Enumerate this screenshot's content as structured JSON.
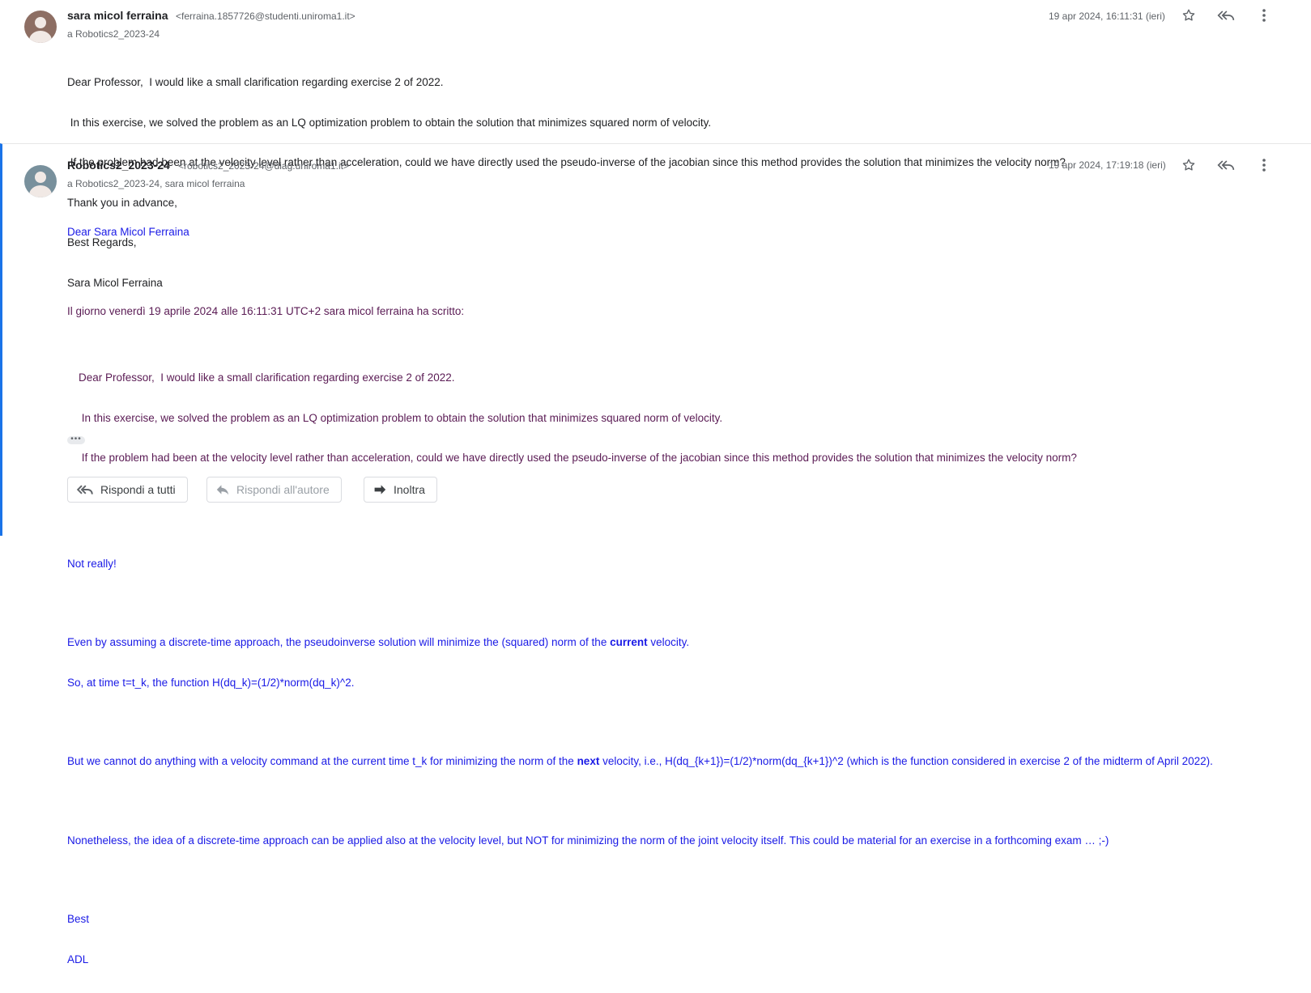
{
  "messages": [
    {
      "sender": "sara micol ferraina",
      "email": "<ferraina.1857726@studenti.uniroma1.it>",
      "recipients": "a Robotics2_2023-24",
      "date": "19 apr 2024, 16:11:31 (ieri)",
      "body": [
        "Dear Professor,  I would like a small clarification regarding exercise 2 of 2022.",
        " In this exercise, we solved the problem as an LQ optimization problem to obtain the solution that minimizes squared norm of velocity.",
        " If the problem had been at the velocity level rather than acceleration, could we have directly used the pseudo-inverse of the jacobian since this method provides the solution that minimizes the velocity norm?",
        "Thank you in advance,",
        "Best Regards,",
        "Sara Micol Ferraina"
      ]
    },
    {
      "sender": "Robotics2_2023-24",
      "email": "<robotics2_2023-24@diag.uniroma1.it>",
      "recipients": "a Robotics2_2023-24, sara micol ferraina",
      "date": "19 apr 2024, 17:19:18 (ieri)",
      "greeting": "Dear Sara Micol Ferraina",
      "quote_header": "Il giorno venerdì 19 aprile 2024 alle 16:11:31 UTC+2 sara micol ferraina ha scritto:",
      "quote": [
        "Dear Professor,  I would like a small clarification regarding exercise 2 of 2022.",
        " In this exercise, we solved the problem as an LQ optimization problem to obtain the solution that minimizes squared norm of velocity.",
        " If the problem had been at the velocity level rather than acceleration, could we have directly used the pseudo-inverse of the jacobian since this method provides the solution that minimizes the velocity norm?"
      ],
      "reply_1": "Not really!",
      "reply_2a": "Even by assuming a discrete-time approach, the pseudoinverse solution will minimize the (squared) norm of the ",
      "reply_2b": "current",
      "reply_2c": " velocity.",
      "reply_3": "So, at time t=t_k, the function H(dq_k)=(1/2)*norm(dq_k)^2.",
      "reply_4a": "But we cannot do anything with a velocity command at the current time t_k for minimizing the norm of the ",
      "reply_4b": "next",
      "reply_4c": " velocity, i.e., H(dq_{k+1})=(1/2)*norm(dq_{k+1})^2 (which is the function considered in exercise 2 of the midterm of April 2022).",
      "reply_5": "Nonetheless, the idea of a discrete-time approach can be applied also at the velocity level, but NOT for minimizing the norm of the joint velocity itself. This could be material for an exercise in a forthcoming exam … ;-)",
      "sign_1": "Best",
      "sign_2": "ADL",
      "dots": "•••"
    }
  ],
  "actions": {
    "reply_all": "Rispondi a tutti",
    "reply_author": "Rispondi all'autore",
    "forward": "Inoltra"
  }
}
